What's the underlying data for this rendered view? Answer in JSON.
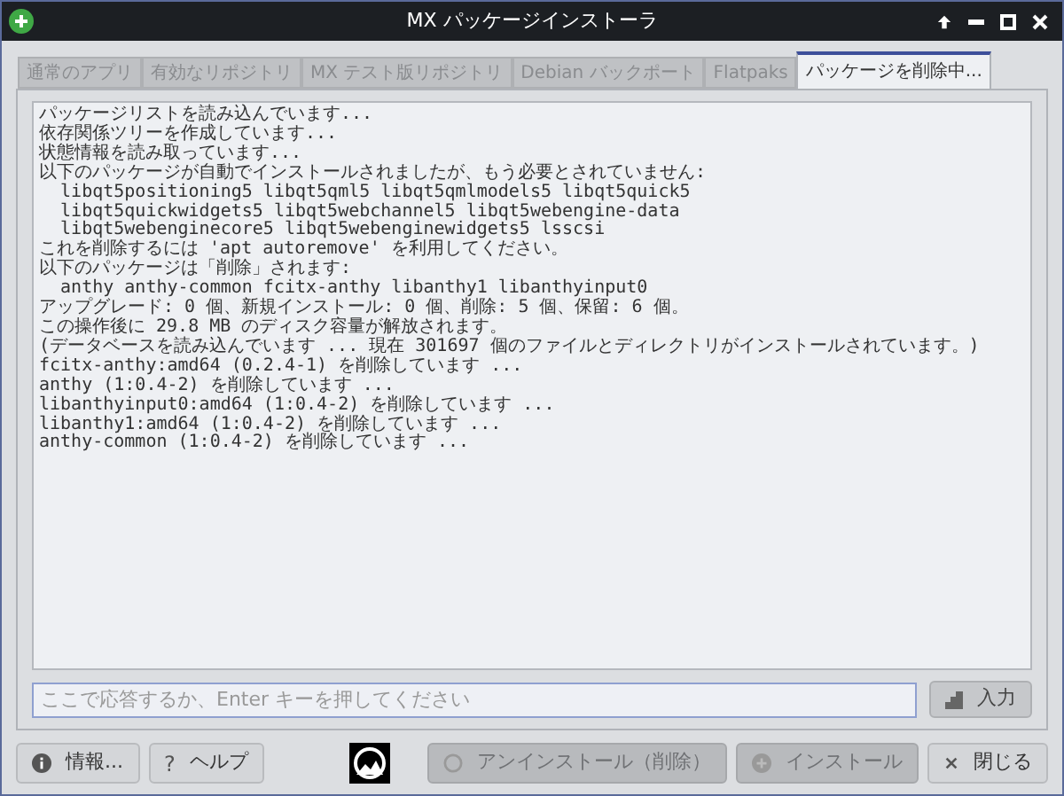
{
  "window": {
    "title": "MX パッケージインストーラ"
  },
  "tabs": [
    {
      "label": "通常のアプリ",
      "selected": false
    },
    {
      "label": "有効なリポジトリ",
      "selected": false
    },
    {
      "label": "MX テスト版リポジトリ",
      "selected": false
    },
    {
      "label": "Debian バックポート",
      "selected": false
    },
    {
      "label": "Flatpaks",
      "selected": false
    },
    {
      "label": "パッケージを削除中...",
      "selected": true
    }
  ],
  "log": [
    "パッケージリストを読み込んでいます...",
    "依存関係ツリーを作成しています...",
    "状態情報を読み取っています...",
    "以下のパッケージが自動でインストールされましたが、もう必要とされていません:",
    "  libqt5positioning5 libqt5qml5 libqt5qmlmodels5 libqt5quick5",
    "  libqt5quickwidgets5 libqt5webchannel5 libqt5webengine-data",
    "  libqt5webenginecore5 libqt5webenginewidgets5 lsscsi",
    "これを削除するには 'apt autoremove' を利用してください。",
    "以下のパッケージは「削除」されます:",
    "  anthy anthy-common fcitx-anthy libanthy1 libanthyinput0",
    "アップグレード: 0 個、新規インストール: 0 個、削除: 5 個、保留: 6 個。",
    "この操作後に 29.8 MB のディスク容量が解放されます。",
    "(データベースを読み込んでいます ... 現在 301697 個のファイルとディレクトリがインストールされています。)",
    "fcitx-anthy:amd64 (0.2.4-1) を削除しています ...",
    "anthy (1:0.4-2) を削除しています ...",
    "libanthyinput0:amd64 (1:0.4-2) を削除しています ...",
    "libanthy1:amd64 (1:0.4-2) を削除しています ...",
    "anthy-common (1:0.4-2) を削除しています ..."
  ],
  "answer": {
    "placeholder": "ここで応答するか、Enter キーを押してください",
    "button": "入力"
  },
  "buttons": [
    {
      "kind": "info",
      "label": "情報...",
      "disabled": false
    },
    {
      "kind": "help",
      "icon": "?",
      "label": "ヘルプ",
      "disabled": false
    },
    {
      "kind": "uninstall",
      "label": "アンインストール（削除）",
      "disabled": true
    },
    {
      "kind": "install",
      "label": "インストール",
      "disabled": true
    },
    {
      "kind": "close",
      "label": "閉じる",
      "disabled": false
    }
  ]
}
